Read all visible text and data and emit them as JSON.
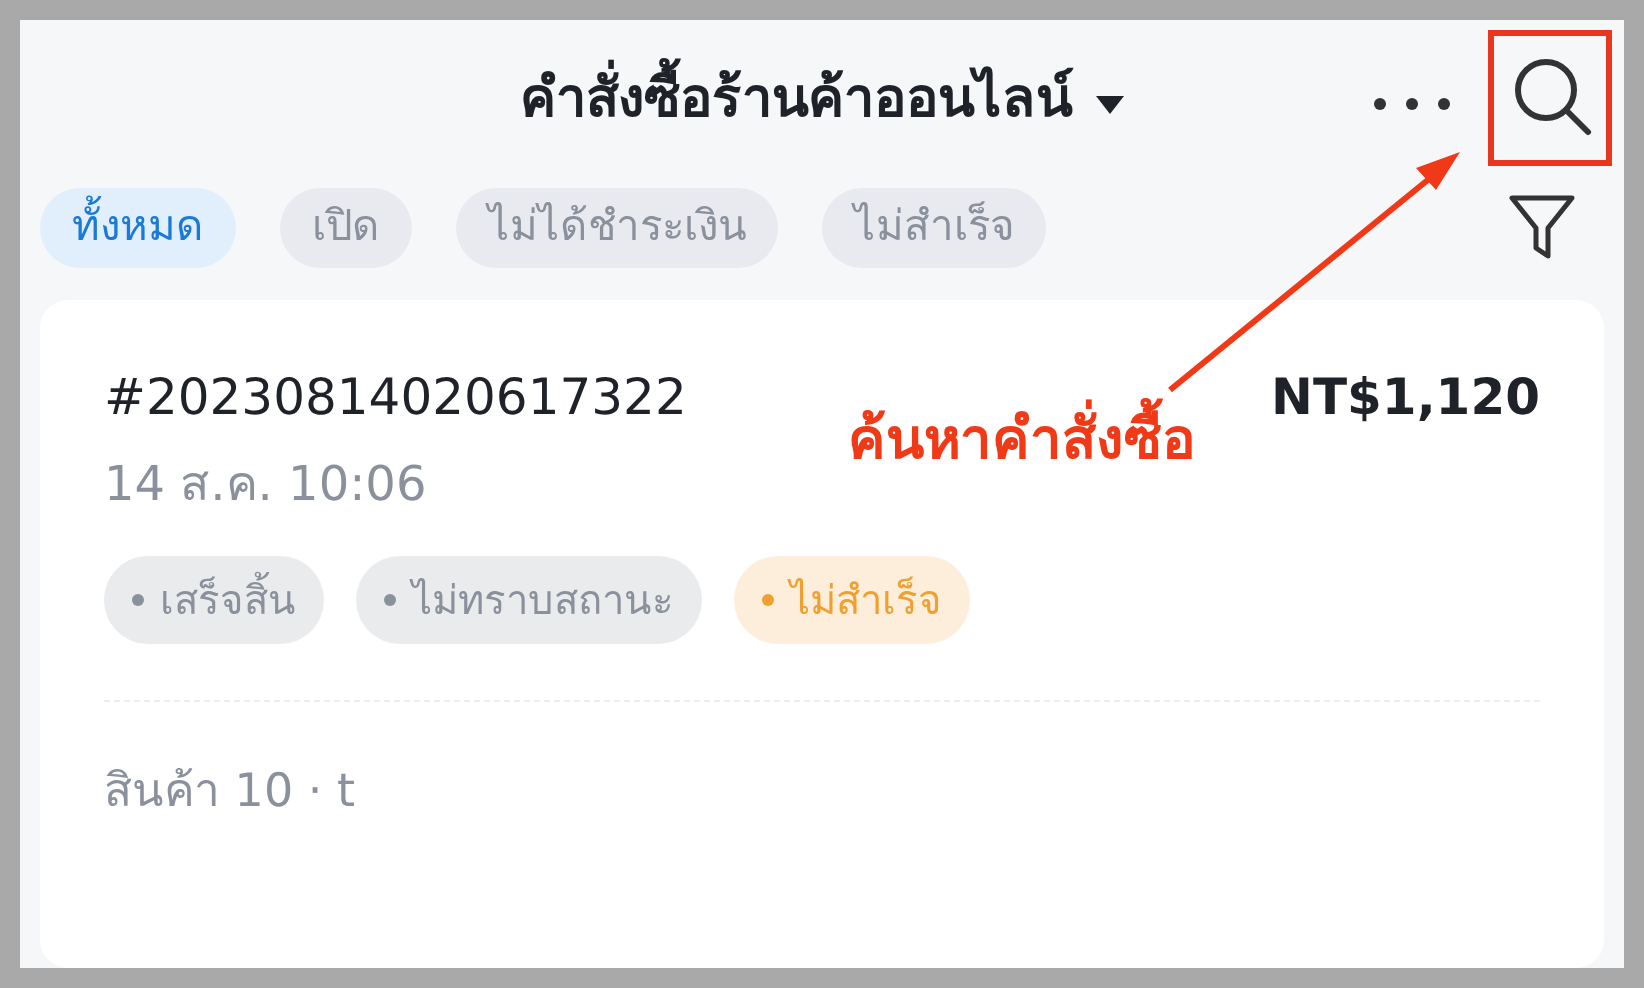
{
  "header": {
    "title": "คำสั่งซื้อร้านค้าออนไลน์"
  },
  "filters": [
    {
      "label": "ทั้งหมด",
      "selected": true
    },
    {
      "label": "เปิด",
      "selected": false
    },
    {
      "label": "ไม่ได้ชำระเงิน",
      "selected": false
    },
    {
      "label": "ไม่สำเร็จ",
      "selected": false
    }
  ],
  "order": {
    "number": "#20230814020617322",
    "total": "NT$1,120",
    "date": "14 ส.ค. 10:06",
    "statuses": [
      {
        "label": "เสร็จสิ้น",
        "color": "#8a909c"
      },
      {
        "label": "ไม่ทราบสถานะ",
        "color": "#8a909c"
      },
      {
        "label": "ไม่สำเร็จ",
        "color": "#f0a030"
      }
    ],
    "items_line": "สินค้า 10 · t"
  },
  "annotation": {
    "text": "ค้นหาคำสั่งซื้อ"
  }
}
